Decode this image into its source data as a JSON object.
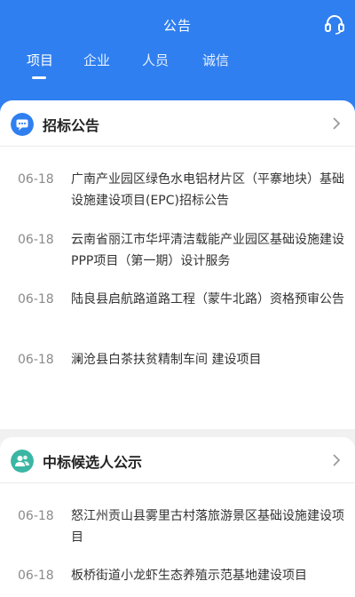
{
  "header": {
    "title": "公告",
    "tabs": [
      {
        "label": "项目",
        "active": true
      },
      {
        "label": "企业",
        "active": false
      },
      {
        "label": "人员",
        "active": false
      },
      {
        "label": "诚信",
        "active": false
      }
    ]
  },
  "sections": [
    {
      "title": "招标公告",
      "icon": "chat-bubble-icon",
      "items": [
        {
          "date": "06-18",
          "text": "广南产业园区绿色水电铝材片区（平寨地块）基础设施建设项目(EPC)招标公告"
        },
        {
          "date": "06-18",
          "text": "云南省丽江市华坪清洁载能产业园区基础设施建设PPP项目（第一期）设计服务"
        },
        {
          "date": "06-18",
          "text": "陆良县启航路道路工程（蒙牛北路）资格预审公告"
        },
        {
          "date": "06-18",
          "text": "澜沧县白茶扶贫精制车间 建设项目"
        }
      ]
    },
    {
      "title": "中标候选人公示",
      "icon": "people-icon",
      "items": [
        {
          "date": "06-18",
          "text": "怒江州贡山县雾里古村落旅游景区基础设施建设项目"
        },
        {
          "date": "06-18",
          "text": "板桥街道小龙虾生态养殖示范基地建设项目"
        }
      ]
    }
  ],
  "colors": {
    "primary": "#2f7ff0",
    "icon_blue": "#2f7ff0",
    "icon_teal": "#3bb6a4"
  }
}
